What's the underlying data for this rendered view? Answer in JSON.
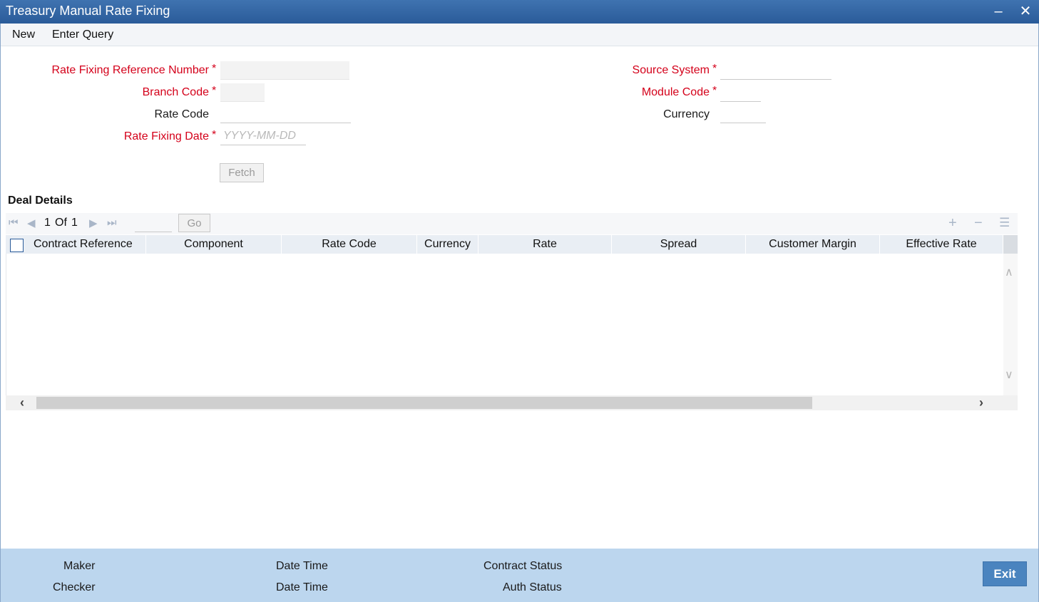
{
  "window": {
    "title": "Treasury Manual Rate Fixing",
    "minimize_icon": "minimize-icon",
    "close_icon": "close-icon"
  },
  "menu": {
    "new": "New",
    "enter_query": "Enter Query"
  },
  "form": {
    "rate_fixing_reference_number": {
      "label": "Rate Fixing Reference Number",
      "required": "*",
      "value": ""
    },
    "branch_code": {
      "label": "Branch Code",
      "required": "*",
      "value": ""
    },
    "rate_code": {
      "label": "Rate Code",
      "value": ""
    },
    "rate_fixing_date": {
      "label": "Rate Fixing Date",
      "required": "*",
      "placeholder": "YYYY-MM-DD",
      "value": ""
    },
    "source_system": {
      "label": "Source System",
      "required": "*",
      "value": ""
    },
    "module_code": {
      "label": "Module Code",
      "required": "*",
      "value": ""
    },
    "currency": {
      "label": "Currency",
      "value": ""
    },
    "fetch_label": "Fetch"
  },
  "deal_details": {
    "title": "Deal Details",
    "pager": {
      "current": "1",
      "of_label": "Of",
      "total": "1",
      "go_label": "Go"
    },
    "columns": [
      "Contract Reference",
      "Component",
      "Rate Code",
      "Currency",
      "Rate",
      "Spread",
      "Customer Margin",
      "Effective Rate"
    ],
    "rows": []
  },
  "footer": {
    "maker": "Maker",
    "checker": "Checker",
    "date_time_1": "Date Time",
    "date_time_2": "Date Time",
    "contract_status": "Contract Status",
    "auth_status": "Auth Status",
    "exit_label": "Exit"
  },
  "colors": {
    "titlebar": "#2a5b99",
    "required_label": "#d4001a",
    "footer_bg": "#bcd6ee",
    "exit_button": "#4a84bf"
  }
}
